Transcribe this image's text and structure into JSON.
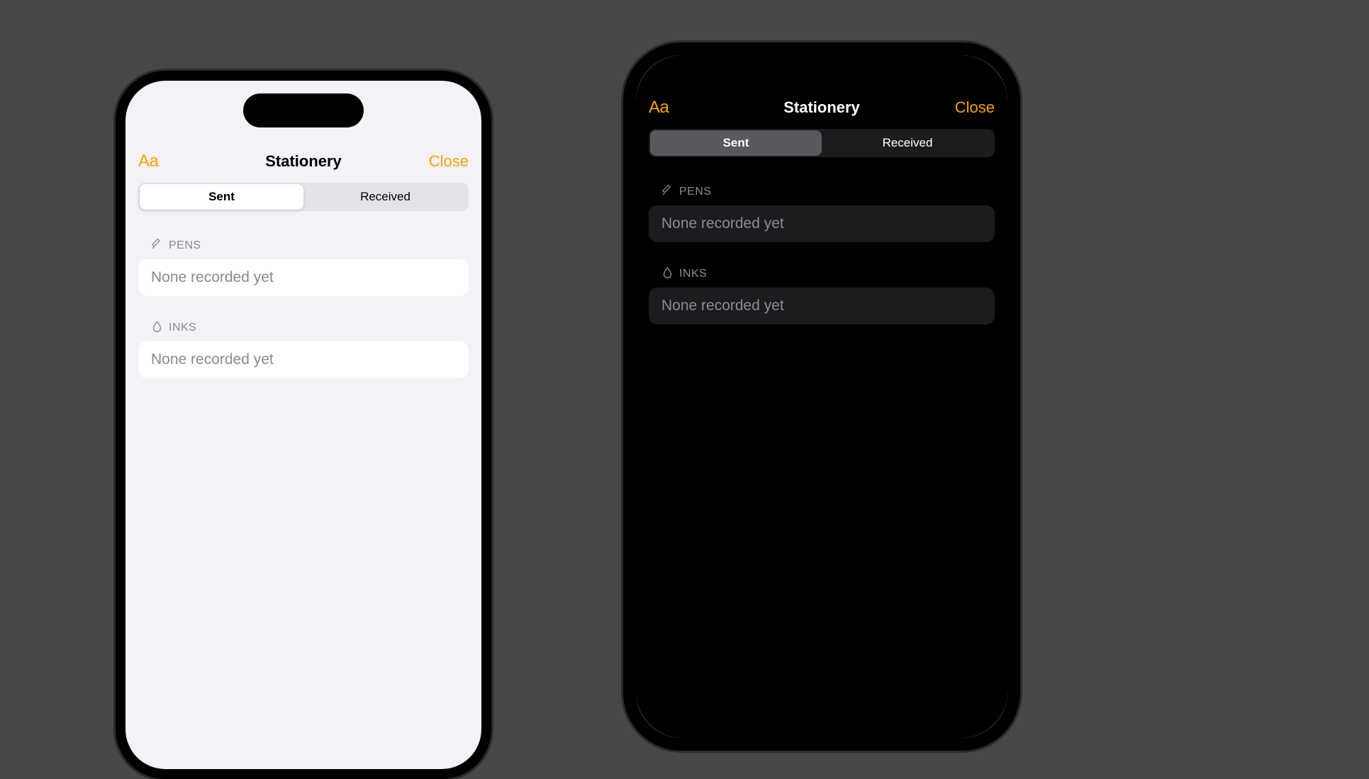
{
  "accent": "#F5A300",
  "nav": {
    "typography_label": "Aa",
    "title": "Stationery",
    "close_label": "Close"
  },
  "segments": {
    "sent": "Sent",
    "received": "Received",
    "selected": "sent"
  },
  "sections": {
    "pens": {
      "header": "PENS",
      "empty": "None recorded yet"
    },
    "inks": {
      "header": "INKS",
      "empty": "None recorded yet"
    }
  }
}
